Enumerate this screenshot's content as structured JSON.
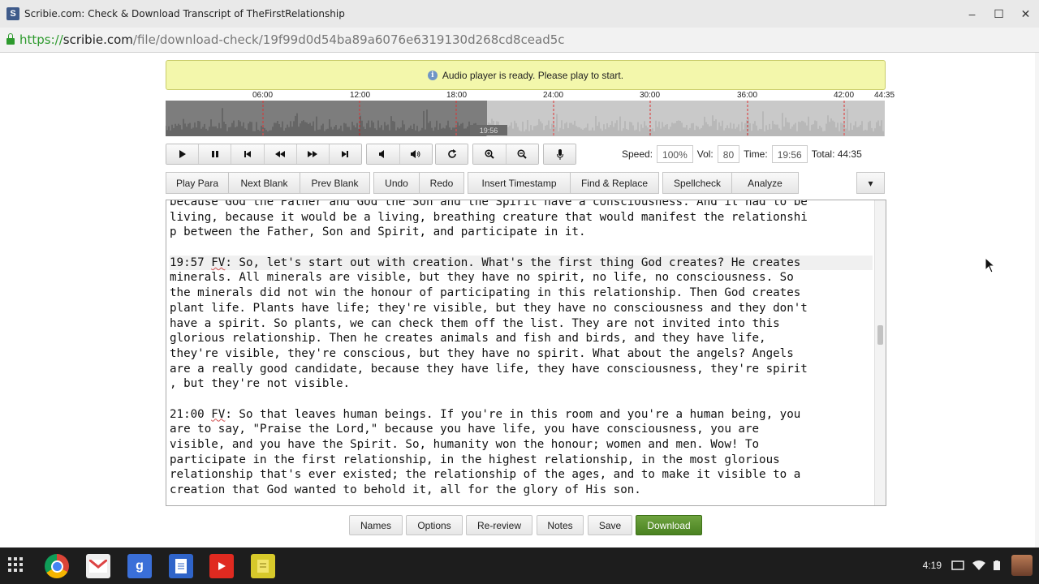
{
  "window": {
    "title": "Scribie.com: Check & Download Transcript of TheFirstRelationship",
    "favicon_letter": "S",
    "minimize": "–",
    "maximize": "☐",
    "close": "✕"
  },
  "address": {
    "protocol": "https://",
    "host": "scribie.com",
    "path": "/file/download-check/19f99d0d54ba89a6076e6319130d268cd8cead5c"
  },
  "notice": {
    "icon": "i",
    "text": "Audio player is ready. Please play to start."
  },
  "waveform": {
    "labels": [
      "06:00",
      "12:00",
      "18:00",
      "24:00",
      "30:00",
      "36:00",
      "42:00",
      "44:35"
    ],
    "current_label": "19:56",
    "played_fraction": 0.447
  },
  "player": {
    "speed_label": "Speed:",
    "speed_value": "100%",
    "vol_label": "Vol:",
    "vol_value": "80",
    "time_label": "Time:",
    "time_value": "19:56",
    "total_text": "Total: 44:35"
  },
  "actions": [
    "Play Para",
    "Next Blank",
    "Prev Blank",
    "Undo",
    "Redo",
    "Insert Timestamp",
    "Find & Replace",
    "Spellcheck",
    "Analyze"
  ],
  "actions_more": "▾",
  "transcript_lines": [
    "because God the Father and God the Son and the Spirit have a consciousness. And it had to be",
    "living, because it would be a living, breathing creature that would manifest the relationshi",
    "p between the Father, Son and Spirit, and participate in it.",
    "",
    "19:57 FV: So, let's start out with creation. What's the first thing God creates? He creates",
    "minerals. All minerals are visible, but they have no spirit, no life, no consciousness. So",
    "the minerals did not win the honour of participating in this relationship. Then God creates",
    "plant life. Plants have life; they're visible, but they have no consciousness and they don't",
    "have a spirit. So plants, we can check them off the list. They are not invited into this",
    "glorious relationship. Then he creates animals and fish and birds, and they have life,",
    "they're visible, they're conscious, but they have no spirit. What about the angels? Angels",
    "are a really good candidate, because they have life, they have consciousness, they're spirit",
    ", but they're not visible.",
    "",
    "21:00 FV: So that leaves human beings. If you're in this room and you're a human being, you",
    "are to say, \"Praise the Lord,\" because you have life, you have consciousness, you are",
    "visible, and you have the Spirit. So, humanity won the honour; women and men. Wow! To",
    "participate in the first relationship, in the highest relationship, in the most glorious",
    "relationship that's ever existed; the relationship of the ages, and to make it visible to a",
    "creation that God wanted to behold it, all for the glory of His son."
  ],
  "bottom_buttons": [
    "Names",
    "Options",
    "Re-review",
    "Notes",
    "Save",
    "Download"
  ],
  "taskbar": {
    "clock": "4:19"
  }
}
